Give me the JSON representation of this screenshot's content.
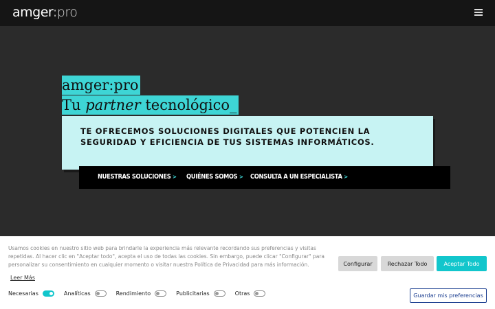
{
  "header": {
    "logo_main": "amger",
    "logo_colon": ":",
    "logo_sub": "pro"
  },
  "hero": {
    "line1": "amger:pro",
    "line2_prefix": "Tu ",
    "line2_emphasis": "partner",
    "line2_suffix": " tecnológico_",
    "tagline": "TE OFRECEMOS SOLUCIONES DIGITALES QUE POTENCIEN LA SEGURIDAD Y EFICIENCIA DE TUS SISTEMAS INFORMÁTICOS."
  },
  "nav": {
    "links": [
      {
        "label": "NUESTRAS SOLUCIONES",
        "arrow": ">"
      },
      {
        "label": "QUIÉNES SOMOS",
        "arrow": ">"
      },
      {
        "label": "CONSULTA A UN ESPECIALISTA",
        "arrow": ">"
      }
    ]
  },
  "cookie": {
    "text": "Usamos cookies en nuestro sitio web para brindarle la experiencia más relevante recordando sus preferencias y visitas repetidas. Al hacer clic en \"Aceptar todo\", acepta el uso de todas las cookies. Sin embargo, puede clicar \"Configurar\" para personalizar su consentimiento en cualquier momento o visitar nuestra Política de Privacidad para más información.",
    "read_more": "Leer Más",
    "configure": "Configurar",
    "reject_all": "Rechazar Todo",
    "accept_all": "Aceptar Todo",
    "save_prefs": "Guardar mis preferencias",
    "toggles": [
      {
        "label": "Necesarias",
        "on": true
      },
      {
        "label": "Analíticas",
        "on": false
      },
      {
        "label": "Rendimiento",
        "on": false
      },
      {
        "label": "Publicitarias",
        "on": false
      },
      {
        "label": "Otras",
        "on": false
      }
    ]
  },
  "colors": {
    "accent": "#3ed5d5",
    "button_accent": "#12c6cc",
    "tagline_bg": "#c7f3f3",
    "page_bg": "#2b2b2b"
  }
}
